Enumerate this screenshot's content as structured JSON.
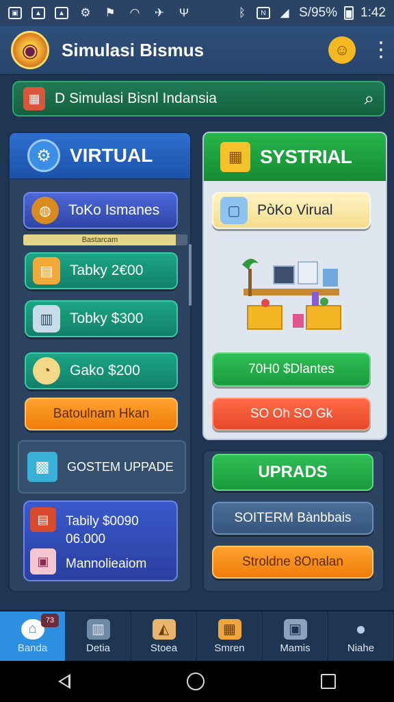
{
  "status_bar": {
    "battery": "S/95%",
    "time": "1:42"
  },
  "app_bar": {
    "title": "Simulasi Bismus",
    "help_icon": "help-badge-icon",
    "menu_icon": "more-vert-icon"
  },
  "search": {
    "text": "D Simulasi Bisnl Indansia",
    "icon": "search-icon"
  },
  "left_panel": {
    "title": "VIRTUAL",
    "buttons": [
      {
        "label": "ToKo Ismanes",
        "icon": "globe-icon"
      },
      {
        "label": "Tabky 2€00",
        "icon": "box-icon"
      },
      {
        "label": "Tobky $300",
        "icon": "register-icon"
      },
      {
        "label": "Gako $200",
        "icon": "clock-icon"
      }
    ],
    "progress": {
      "label": "Bastarcam",
      "value": 0.93
    },
    "orange_button": "Batoulnam Hkan",
    "upgrade": {
      "label": "GOSTEM UPPADE",
      "icon": "gift-box-icon"
    },
    "store": {
      "line1": "Tabily $0090",
      "line2": "06.000",
      "line3": "Mannolieaiom"
    }
  },
  "right_panel": {
    "title": "SYSTRIAL",
    "store_button": "PòKo Virual",
    "green_button": "70H0 $Dlantes",
    "red_button": "SO Oh SO Gk",
    "upgrades_button": "UPRADS",
    "system_button": "SOITERM Bànbbais",
    "orange_button": "Stroldne 8Onalan"
  },
  "bottom_nav": [
    {
      "label": "Banda",
      "icon": "home-icon",
      "active": true
    },
    {
      "label": "Detia",
      "icon": "storefront-icon"
    },
    {
      "label": "Stoea",
      "icon": "shop-icon"
    },
    {
      "label": "Smren",
      "icon": "crate-icon"
    },
    {
      "label": "Mamis",
      "icon": "briefcase-icon"
    },
    {
      "label": "Niahe",
      "icon": "profile-icon"
    }
  ],
  "nav_badge": "73"
}
